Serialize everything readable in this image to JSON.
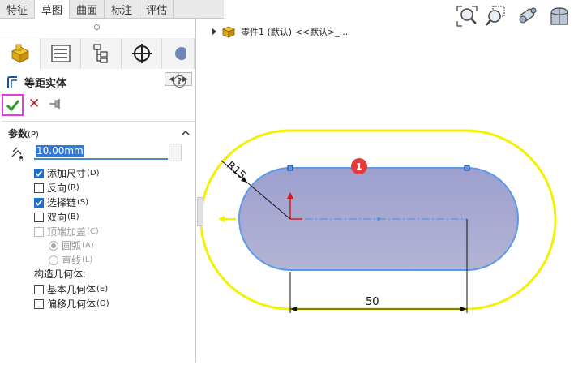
{
  "command_tabs": [
    "特征",
    "草图",
    "曲面",
    "标注",
    "评估"
  ],
  "active_tab_index": 1,
  "feature": {
    "title": "等距实体",
    "help": "?"
  },
  "params": {
    "group_label": "参数",
    "group_key": "(P)",
    "distance_value": "10.00mm",
    "options": [
      {
        "label": "添加尺寸",
        "key": "(D)",
        "checked": true,
        "enabled": true
      },
      {
        "label": "反向",
        "key": "(R)",
        "checked": false,
        "enabled": true
      },
      {
        "label": "选择链",
        "key": "(S)",
        "checked": true,
        "enabled": true
      },
      {
        "label": "双向",
        "key": "(B)",
        "checked": false,
        "enabled": true
      },
      {
        "label": "顶端加盖",
        "key": "(C)",
        "checked": false,
        "enabled": false
      }
    ],
    "cap_options": [
      {
        "label": "圆弧",
        "key": "(A)",
        "selected": true
      },
      {
        "label": "直线",
        "key": "(L)",
        "selected": false
      }
    ],
    "construct_label": "构造几何体:",
    "construct_options": [
      {
        "label": "基本几何体",
        "key": "(E)",
        "checked": false
      },
      {
        "label": "偏移几何体",
        "key": "(O)",
        "checked": false
      }
    ]
  },
  "graphics": {
    "tree_text": "零件1 (默认) <<默认>_...",
    "dim_radius": "R15",
    "dim_length": "50",
    "badge": "1"
  },
  "icons": [
    "zoom-fit-icon",
    "zoom-area-icon",
    "previous-view-icon",
    "section-view-icon"
  ],
  "colors": {
    "offset_outline": "#f2f200",
    "slot_fill": "#a9aad0",
    "slot_edge": "#5b9ae8",
    "badge": "#e23c3c",
    "ok_highlight": "#e23ce0"
  }
}
